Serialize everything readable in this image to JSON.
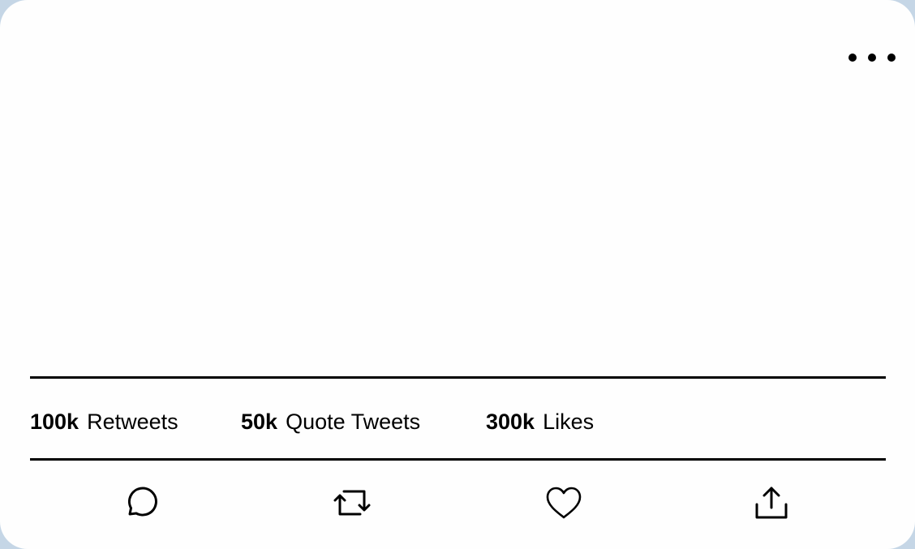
{
  "menu": {
    "icon": "more-horizontal-icon"
  },
  "stats": [
    {
      "count": "100k",
      "label": "Retweets"
    },
    {
      "count": "50k",
      "label": "Quote Tweets"
    },
    {
      "count": "300k",
      "label": "Likes"
    }
  ],
  "actions": [
    {
      "icon": "reply-icon"
    },
    {
      "icon": "retweet-icon"
    },
    {
      "icon": "like-icon"
    },
    {
      "icon": "share-icon"
    }
  ],
  "colors": {
    "text": "#000000",
    "card_background": "#fefefe",
    "page_background": "#c5d6e6"
  }
}
